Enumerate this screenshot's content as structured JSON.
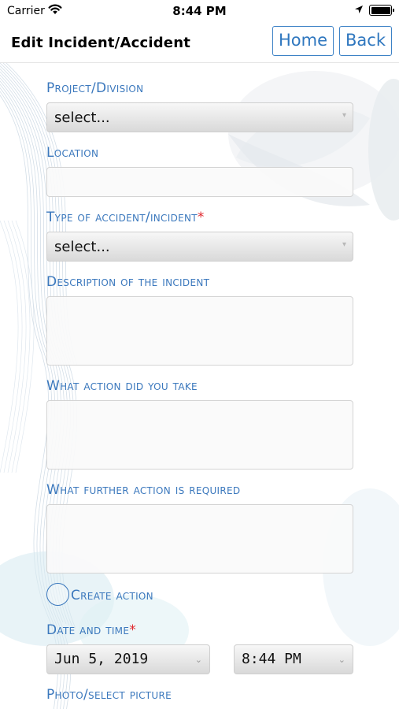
{
  "status_bar": {
    "carrier": "Carrier",
    "time": "8:44 PM"
  },
  "nav": {
    "title": "Edit Incident/Accident",
    "home_label": "Home",
    "back_label": "Back"
  },
  "form": {
    "project_label": "Project/Division",
    "project_value": "select...",
    "location_label": "Location",
    "location_value": "",
    "type_label": "Type of accident/incident",
    "type_required": "*",
    "type_value": "select...",
    "description_label": "Description of the incident",
    "description_value": "",
    "action_taken_label": "What action did you take",
    "action_taken_value": "",
    "further_action_label": "What further action is required",
    "further_action_value": "",
    "create_action_label": "Create action",
    "create_action_checked": false,
    "datetime_label": "Date and time",
    "datetime_required": "*",
    "date_value": "Jun 5, 2019",
    "time_value": "8:44 PM",
    "photo_label": "Photo/select picture"
  },
  "colors": {
    "accent": "#3b78bd",
    "required": "#e0262c",
    "nav_button_border": "#3d82c6"
  },
  "icons": {
    "wifi": "wifi-icon",
    "location": "location-arrow-icon",
    "battery": "battery-icon",
    "chevron": "chevron-down-icon"
  }
}
